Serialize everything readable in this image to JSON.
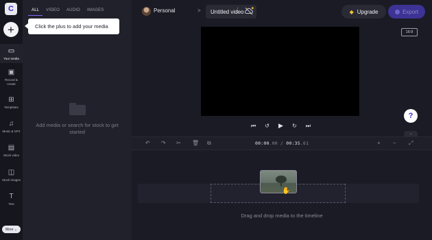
{
  "app": {
    "logo_letter": "C"
  },
  "rail": {
    "add_icon": "plus-icon",
    "items": [
      {
        "label": "Your media",
        "icon": "folder-icon",
        "glyph": "▭",
        "active": true
      },
      {
        "label": "Record &\ncreate",
        "icon": "camera-icon",
        "glyph": "▣",
        "active": false
      },
      {
        "label": "Templates",
        "icon": "templates-icon",
        "glyph": "⊞",
        "active": false
      },
      {
        "label": "Music & SFX",
        "icon": "music-icon",
        "glyph": "♫",
        "active": false
      },
      {
        "label": "Stock video",
        "icon": "film-icon",
        "glyph": "▤",
        "active": false
      },
      {
        "label": "Stock images",
        "icon": "image-icon",
        "glyph": "◫",
        "active": false
      },
      {
        "label": "Text",
        "icon": "text-icon",
        "glyph": "T",
        "active": false
      }
    ],
    "more_label": "More ⌄"
  },
  "media_panel": {
    "tabs": [
      {
        "label": "ALL",
        "active": true
      },
      {
        "label": "VIDEO",
        "active": false
      },
      {
        "label": "AUDIO",
        "active": false
      },
      {
        "label": "IMAGES",
        "active": false
      }
    ],
    "empty_text": "Add media or search for stock to get started",
    "tooltip": "Click the plus to add your media"
  },
  "header": {
    "workspace": "Personal",
    "separator": ">",
    "project_title": "Untitled video",
    "upgrade_label": "Upgrade",
    "export_label": "Export"
  },
  "preview": {
    "aspect_ratio": "16:9",
    "help_label": "?",
    "chevron": "⌄"
  },
  "timeline": {
    "timecode_current_main": "00:00",
    "timecode_current_frac": ".00",
    "timecode_sep": " / ",
    "timecode_total_main": "00:35",
    "timecode_total_frac": ".61",
    "drop_hint": "Drag and drop media to the timeline"
  },
  "colors": {
    "accent": "#7b6cf6",
    "export_bg": "#3c3394",
    "upgrade_gem": "#f1c232",
    "panel_bg": "#21212b",
    "app_bg": "#1b1b25"
  }
}
